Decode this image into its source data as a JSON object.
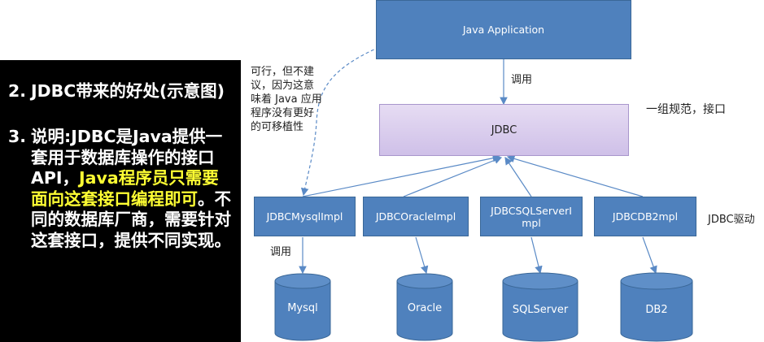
{
  "left_panel": {
    "item2_num": "2.",
    "item2_text": "JDBC带来的好处(示意图)",
    "item3_num": "3.",
    "item3_text_a": "说明:JDBC是Java提供一套用于数据库操作的接口API，",
    "item3_text_highlight": "Java程序员只需要面向这套接口编程即可",
    "item3_text_b": "。不同的数据库厂商，需要针对这套接口，提供不同实现。"
  },
  "diagram": {
    "java_app": "Java Application",
    "jdbc": "JDBC",
    "call_label_top": "调用",
    "call_label_bottom": "调用",
    "interface_label": "一组规范，接口",
    "driver_label": "JDBC驱动",
    "note_lines": [
      "可行，但不建",
      "议，因为这意",
      "味着 Java 应用",
      "程序没有更好",
      "的可移植性"
    ],
    "impls": [
      "JDBCMysqlImpl",
      "JDBCOracleImpl",
      "JDBCSQLServerImpl",
      "JDBCDB2mpl"
    ],
    "databases": [
      "Mysql",
      "Oracle",
      "SQLServer",
      "DB2"
    ]
  },
  "colors": {
    "box_blue": "#4f81bd",
    "jdbc_purple": "#d9cdee",
    "highlight_yellow": "#ffff33",
    "panel_black": "#000000",
    "corner_teal": "#1fb5a0"
  }
}
